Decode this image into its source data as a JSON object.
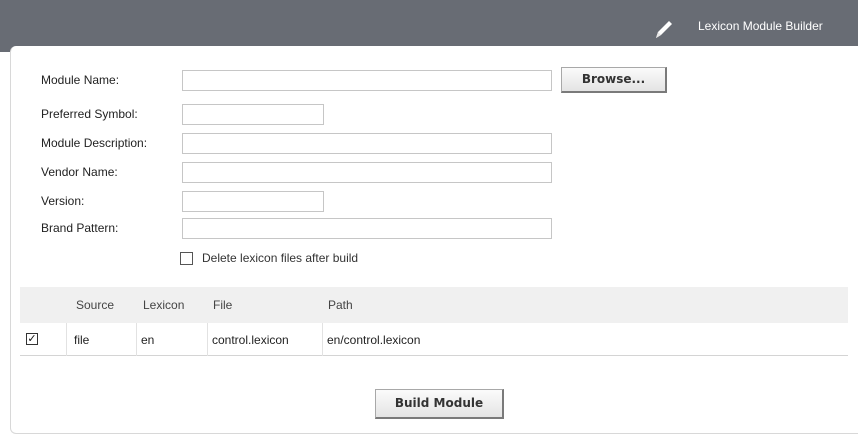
{
  "header": {
    "title": "Lexicon Module Builder",
    "icon": "pencil-icon"
  },
  "form": {
    "module_name_label": "Module Name:",
    "module_name_value": "",
    "browse_label": "Browse...",
    "preferred_symbol_label": "Preferred Symbol:",
    "preferred_symbol_value": "",
    "module_description_label": "Module Description:",
    "module_description_value": "",
    "vendor_name_label": "Vendor Name:",
    "vendor_name_value": "",
    "version_label": "Version:",
    "version_value": "",
    "brand_pattern_label": "Brand Pattern:",
    "brand_pattern_value": "",
    "delete_files_label": "Delete lexicon files after build",
    "delete_files_checked": false
  },
  "table": {
    "columns": [
      "Source",
      "Lexicon",
      "File",
      "Path"
    ],
    "rows": [
      {
        "checked": true,
        "source": "file",
        "lexicon": "en",
        "file": "control.lexicon",
        "path": "en/control.lexicon"
      }
    ]
  },
  "actions": {
    "build_label": "Build Module"
  },
  "colors": {
    "header_bg": "#686c74",
    "table_header_bg": "#f0f0f0"
  }
}
